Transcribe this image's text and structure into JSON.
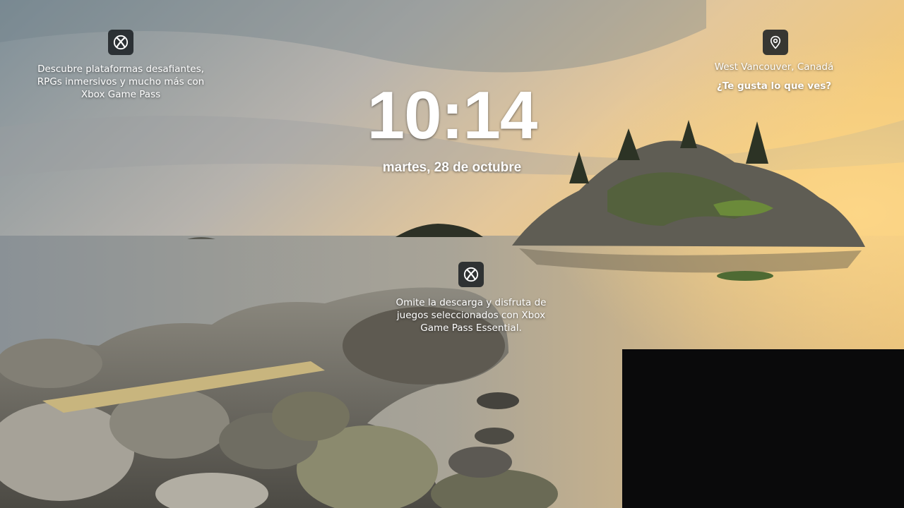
{
  "lockscreen": {
    "time": "10:14",
    "date": "martes, 28 de octubre"
  },
  "spotlight": {
    "location": "West Vancouver, Canadá",
    "like_prompt": "¿Te gusta lo que ves?"
  },
  "widgets": {
    "promo_top_left": {
      "icon": "xbox-icon",
      "text": "Descubre plataformas desafiantes, RPGs inmersivos y mucho más con Xbox Game Pass"
    },
    "promo_center": {
      "icon": "xbox-icon",
      "text": "Omite la descarga y disfruta de juegos seleccionados con Xbox Game Pass Essential."
    },
    "location_icon": "location-pin-icon"
  },
  "colors": {
    "icon_chip_bg": "#1e2226",
    "text": "#ffffff",
    "panel_bg": "#0a0a0b"
  }
}
